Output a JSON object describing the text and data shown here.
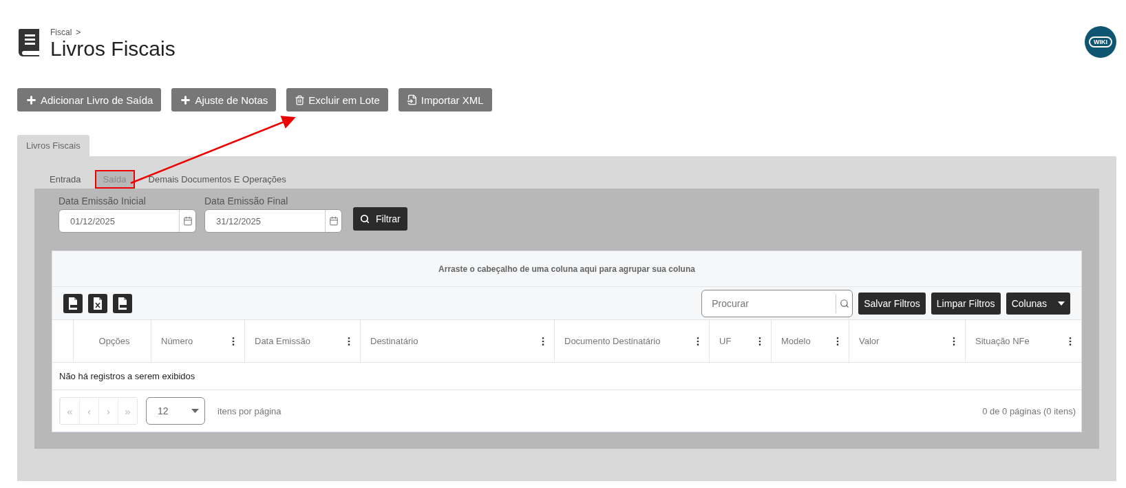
{
  "breadcrumb": {
    "parent": "Fiscal",
    "separator": ">"
  },
  "title": "Livros Fiscais",
  "wiki_badge": "WIKI",
  "actions": [
    {
      "label": "Adicionar Livro de Saída",
      "kind": "add"
    },
    {
      "label": "Ajuste de Notas",
      "kind": "add"
    },
    {
      "label": "Excluir em Lote",
      "kind": "delete"
    },
    {
      "label": "Importar XML",
      "kind": "import"
    }
  ],
  "outer_tabs": [
    {
      "label": "Livros Fiscais",
      "selected": true
    }
  ],
  "inner_tabs": [
    {
      "label": "Entrada",
      "selected": false,
      "highlighted": false
    },
    {
      "label": "Saída",
      "selected": true,
      "highlighted": true
    },
    {
      "label": "Demais Documentos E Operações",
      "selected": false,
      "highlighted": false
    }
  ],
  "filters": [
    {
      "label": "Data Emissão Inicial",
      "value": "01/12/2025"
    },
    {
      "label": "Data Emissão Final",
      "value": "31/12/2025"
    }
  ],
  "filter_button": "Filtrar",
  "grid": {
    "group_hint": "Arraste o cabeçalho de uma coluna aqui para agrupar sua coluna",
    "exports": [
      {
        "kind": "pdf"
      },
      {
        "kind": "excel"
      },
      {
        "kind": "csv"
      }
    ],
    "search": {
      "placeholder": "Procurar"
    },
    "toolbar_buttons": [
      {
        "label": "Salvar Filtros",
        "dropdown": false
      },
      {
        "label": "Limpar Filtros",
        "dropdown": false
      },
      {
        "label": "Colunas",
        "dropdown": true
      }
    ],
    "columns": [
      {
        "label": "Opções",
        "menu": false
      },
      {
        "label": "Número",
        "menu": true
      },
      {
        "label": "Data Emissão",
        "menu": true
      },
      {
        "label": "Destinatário",
        "menu": true
      },
      {
        "label": "Documento Destinatário",
        "menu": true
      },
      {
        "label": "UF",
        "menu": true
      },
      {
        "label": "Modelo",
        "menu": true
      },
      {
        "label": "Valor",
        "menu": true
      },
      {
        "label": "Situação NFe",
        "menu": true
      }
    ],
    "empty_message": "Não há registros a serem exibidos",
    "pager": {
      "buttons": [
        "«",
        "‹",
        "›",
        "»"
      ],
      "page_size": "12",
      "page_size_label": "itens por página",
      "summary": "0 de 0 páginas (0 itens)"
    }
  }
}
